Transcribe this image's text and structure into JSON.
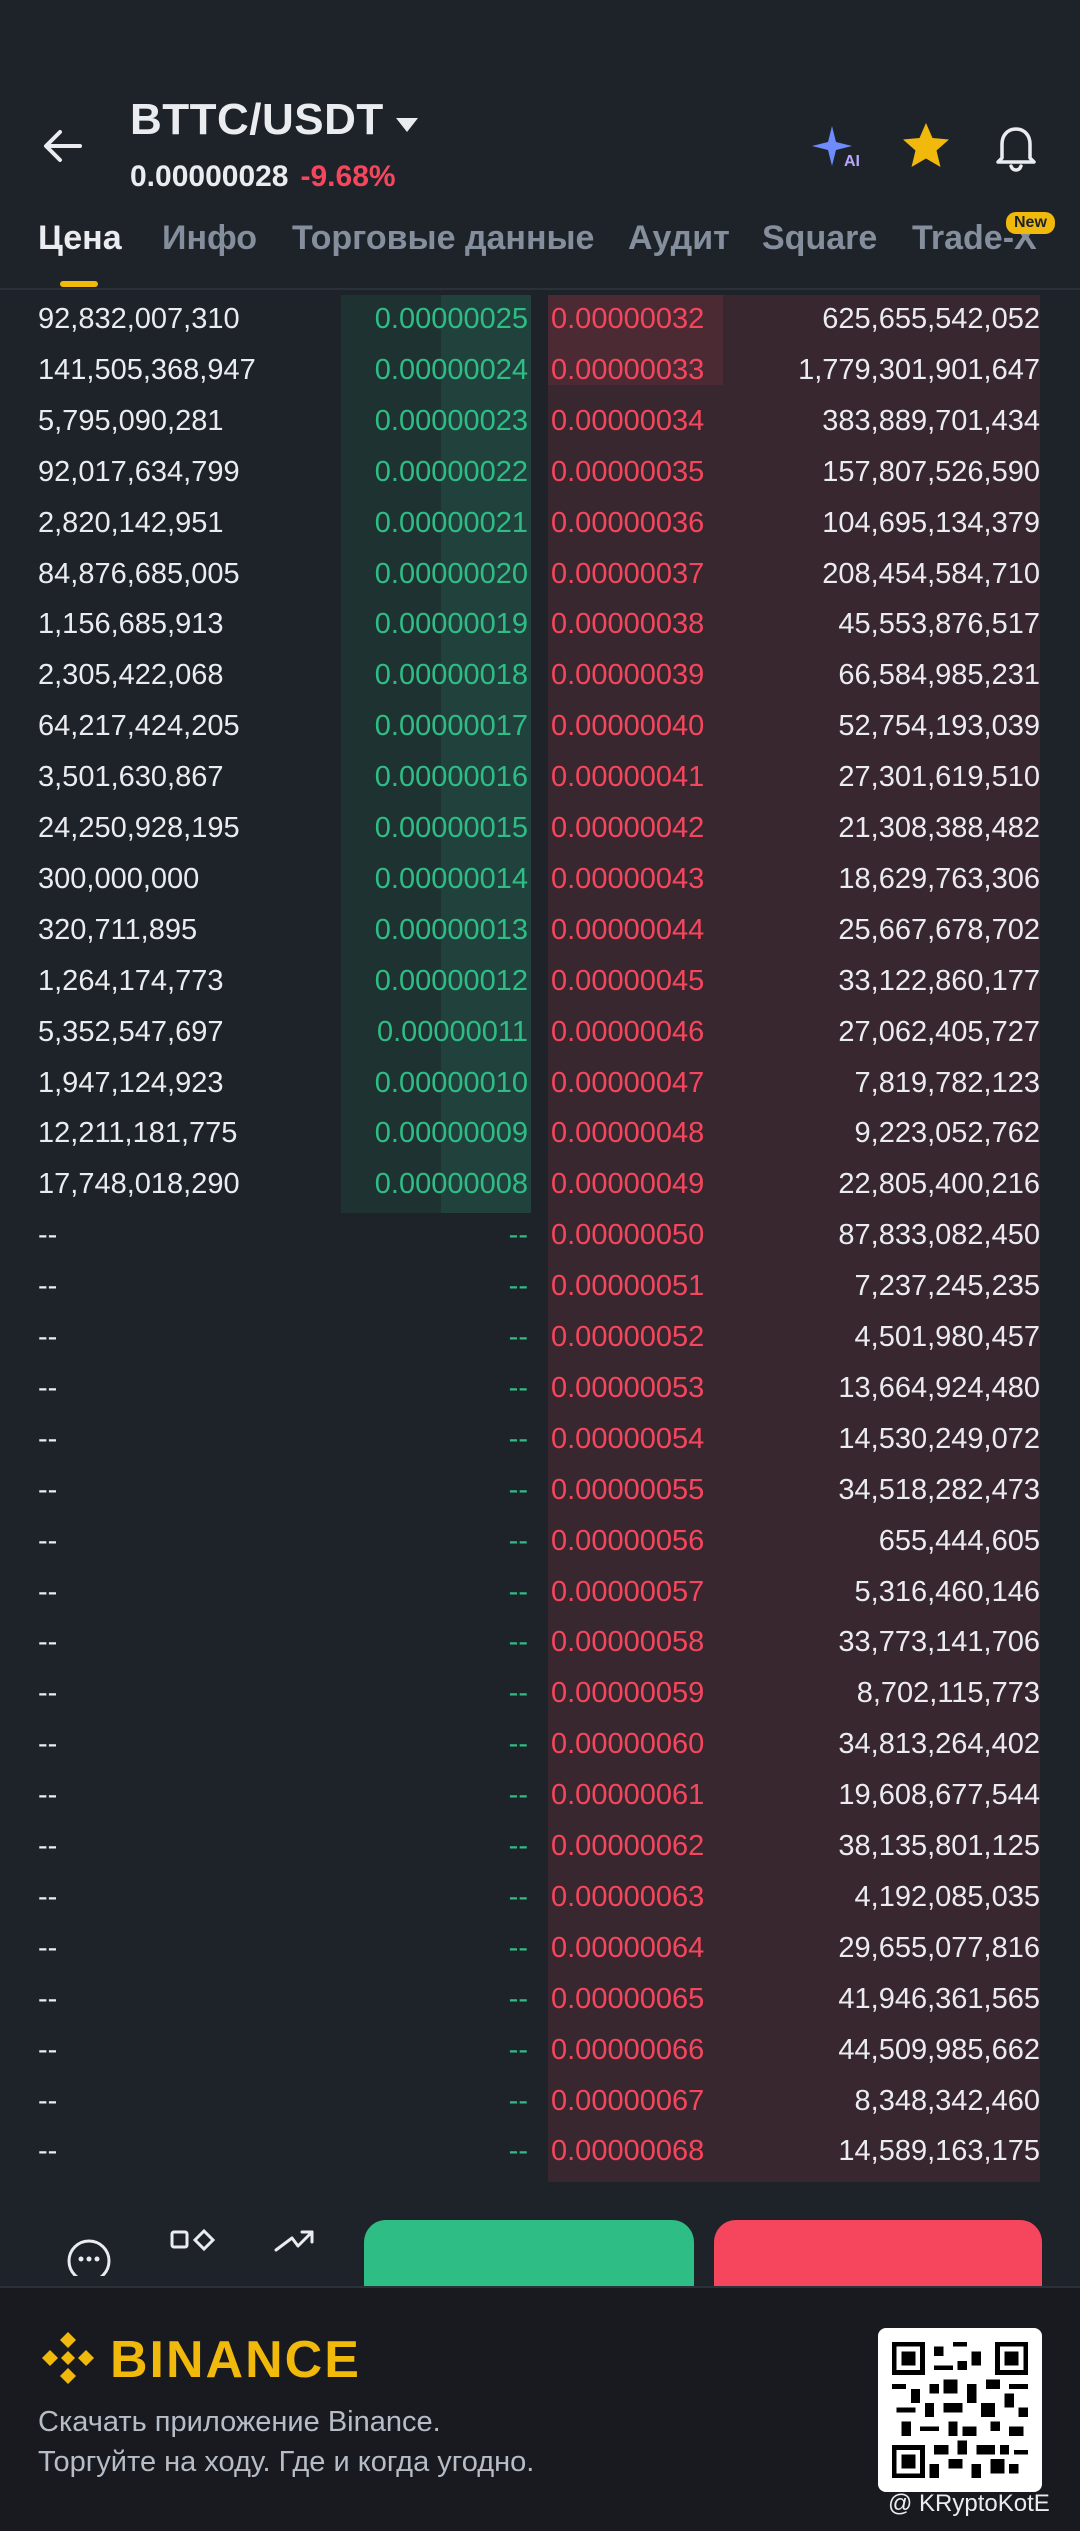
{
  "header": {
    "pair": "BTTC/USDT",
    "price": "0.00000028",
    "change": "-9.68%",
    "tabs": [
      "Цена",
      "Инфо",
      "Торговые данные",
      "Аудит",
      "Square",
      "Trade-X"
    ],
    "active_tab": 0,
    "new_badge": "New",
    "icons": [
      "back-arrow-icon",
      "ai-sparkle-icon",
      "star-icon",
      "bell-icon"
    ],
    "colors": {
      "accent": "#f0b90b",
      "up": "#2ebd85",
      "down": "#f6465d",
      "bg": "#1e2329"
    }
  },
  "orderbook": {
    "rows": [
      {
        "bid_qty": "92,832,007,310",
        "bid_price": "0.00000025",
        "ask_price": "0.00000032",
        "ask_qty": "625,655,542,052"
      },
      {
        "bid_qty": "141,505,368,947",
        "bid_price": "0.00000024",
        "ask_price": "0.00000033",
        "ask_qty": "1,779,301,901,647"
      },
      {
        "bid_qty": "5,795,090,281",
        "bid_price": "0.00000023",
        "ask_price": "0.00000034",
        "ask_qty": "383,889,701,434"
      },
      {
        "bid_qty": "92,017,634,799",
        "bid_price": "0.00000022",
        "ask_price": "0.00000035",
        "ask_qty": "157,807,526,590"
      },
      {
        "bid_qty": "2,820,142,951",
        "bid_price": "0.00000021",
        "ask_price": "0.00000036",
        "ask_qty": "104,695,134,379"
      },
      {
        "bid_qty": "84,876,685,005",
        "bid_price": "0.00000020",
        "ask_price": "0.00000037",
        "ask_qty": "208,454,584,710"
      },
      {
        "bid_qty": "1,156,685,913",
        "bid_price": "0.00000019",
        "ask_price": "0.00000038",
        "ask_qty": "45,553,876,517"
      },
      {
        "bid_qty": "2,305,422,068",
        "bid_price": "0.00000018",
        "ask_price": "0.00000039",
        "ask_qty": "66,584,985,231"
      },
      {
        "bid_qty": "64,217,424,205",
        "bid_price": "0.00000017",
        "ask_price": "0.00000040",
        "ask_qty": "52,754,193,039"
      },
      {
        "bid_qty": "3,501,630,867",
        "bid_price": "0.00000016",
        "ask_price": "0.00000041",
        "ask_qty": "27,301,619,510"
      },
      {
        "bid_qty": "24,250,928,195",
        "bid_price": "0.00000015",
        "ask_price": "0.00000042",
        "ask_qty": "21,308,388,482"
      },
      {
        "bid_qty": "300,000,000",
        "bid_price": "0.00000014",
        "ask_price": "0.00000043",
        "ask_qty": "18,629,763,306"
      },
      {
        "bid_qty": "320,711,895",
        "bid_price": "0.00000013",
        "ask_price": "0.00000044",
        "ask_qty": "25,667,678,702"
      },
      {
        "bid_qty": "1,264,174,773",
        "bid_price": "0.00000012",
        "ask_price": "0.00000045",
        "ask_qty": "33,122,860,177"
      },
      {
        "bid_qty": "5,352,547,697",
        "bid_price": "0.00000011",
        "ask_price": "0.00000046",
        "ask_qty": "27,062,405,727"
      },
      {
        "bid_qty": "1,947,124,923",
        "bid_price": "0.00000010",
        "ask_price": "0.00000047",
        "ask_qty": "7,819,782,123"
      },
      {
        "bid_qty": "12,211,181,775",
        "bid_price": "0.00000009",
        "ask_price": "0.00000048",
        "ask_qty": "9,223,052,762"
      },
      {
        "bid_qty": "17,748,018,290",
        "bid_price": "0.00000008",
        "ask_price": "0.00000049",
        "ask_qty": "22,805,400,216"
      },
      {
        "bid_qty": "--",
        "bid_price": "--",
        "ask_price": "0.00000050",
        "ask_qty": "87,833,082,450"
      },
      {
        "bid_qty": "--",
        "bid_price": "--",
        "ask_price": "0.00000051",
        "ask_qty": "7,237,245,235"
      },
      {
        "bid_qty": "--",
        "bid_price": "--",
        "ask_price": "0.00000052",
        "ask_qty": "4,501,980,457"
      },
      {
        "bid_qty": "--",
        "bid_price": "--",
        "ask_price": "0.00000053",
        "ask_qty": "13,664,924,480"
      },
      {
        "bid_qty": "--",
        "bid_price": "--",
        "ask_price": "0.00000054",
        "ask_qty": "14,530,249,072"
      },
      {
        "bid_qty": "--",
        "bid_price": "--",
        "ask_price": "0.00000055",
        "ask_qty": "34,518,282,473"
      },
      {
        "bid_qty": "--",
        "bid_price": "--",
        "ask_price": "0.00000056",
        "ask_qty": "655,444,605"
      },
      {
        "bid_qty": "--",
        "bid_price": "--",
        "ask_price": "0.00000057",
        "ask_qty": "5,316,460,146"
      },
      {
        "bid_qty": "--",
        "bid_price": "--",
        "ask_price": "0.00000058",
        "ask_qty": "33,773,141,706"
      },
      {
        "bid_qty": "--",
        "bid_price": "--",
        "ask_price": "0.00000059",
        "ask_qty": "8,702,115,773"
      },
      {
        "bid_qty": "--",
        "bid_price": "--",
        "ask_price": "0.00000060",
        "ask_qty": "34,813,264,402"
      },
      {
        "bid_qty": "--",
        "bid_price": "--",
        "ask_price": "0.00000061",
        "ask_qty": "19,608,677,544"
      },
      {
        "bid_qty": "--",
        "bid_price": "--",
        "ask_price": "0.00000062",
        "ask_qty": "38,135,801,125"
      },
      {
        "bid_qty": "--",
        "bid_price": "--",
        "ask_price": "0.00000063",
        "ask_qty": "4,192,085,035"
      },
      {
        "bid_qty": "--",
        "bid_price": "--",
        "ask_price": "0.00000064",
        "ask_qty": "29,655,077,816"
      },
      {
        "bid_qty": "--",
        "bid_price": "--",
        "ask_price": "0.00000065",
        "ask_qty": "41,946,361,565"
      },
      {
        "bid_qty": "--",
        "bid_price": "--",
        "ask_price": "0.00000066",
        "ask_qty": "44,509,985,662"
      },
      {
        "bid_qty": "--",
        "bid_price": "--",
        "ask_price": "0.00000067",
        "ask_qty": "8,348,342,460"
      },
      {
        "bid_qty": "--",
        "bid_price": "--",
        "ask_price": "0.00000068",
        "ask_qty": "14,589,163,175"
      }
    ]
  },
  "bottom_bar": {
    "icons": [
      "more-icon",
      "grid-icon",
      "share-icon"
    ],
    "buy_color": "#2ebd85",
    "sell_color": "#f6465d"
  },
  "banner": {
    "brand": "BINANCE",
    "line1": "Скачать приложение Binance.",
    "line2": "Торгуйте на ходу. Где и когда угодно.",
    "watermark": "@ KRyptoKotE"
  }
}
